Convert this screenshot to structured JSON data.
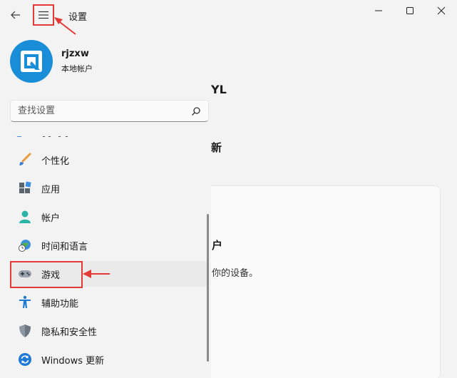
{
  "app": {
    "title": "设置"
  },
  "window_controls": {
    "minimize": "minimize-icon",
    "maximize": "maximize-icon",
    "close": "close-icon"
  },
  "profile": {
    "name": "rjzxw",
    "type": "本地帐户"
  },
  "search": {
    "placeholder": "查找设置"
  },
  "nav": {
    "items": [
      {
        "label": "个性化",
        "icon": "brush-icon"
      },
      {
        "label": "应用",
        "icon": "apps-icon"
      },
      {
        "label": "帐户",
        "icon": "account-icon"
      },
      {
        "label": "时间和语言",
        "icon": "globe-clock-icon"
      },
      {
        "label": "游戏",
        "icon": "gamepad-icon",
        "selected": true
      },
      {
        "label": "辅助功能",
        "icon": "accessibility-icon"
      },
      {
        "label": "隐私和安全性",
        "icon": "shield-icon"
      },
      {
        "label": "Windows 更新",
        "icon": "update-icon"
      }
    ]
  },
  "content": {
    "user_partial": "YL",
    "section_partial": "新",
    "card_title_partial": "户",
    "card_desc_partial": "你的设备。"
  },
  "colors": {
    "accent": "#1a8dd8",
    "annotation": "#e53935"
  }
}
